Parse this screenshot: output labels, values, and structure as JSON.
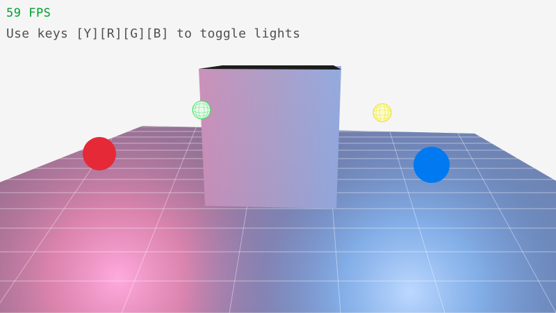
{
  "hud": {
    "fps": "59 FPS",
    "help": "Use keys [Y][R][G][B] to toggle lights"
  },
  "scene": {
    "background": "#f5f5f5",
    "cube_color": "#a7a0c8",
    "lights": [
      {
        "name": "yellow",
        "key": "Y",
        "color": "#fdf500",
        "enabled": false
      },
      {
        "name": "red",
        "key": "R",
        "color": "#e62937",
        "enabled": true
      },
      {
        "name": "green",
        "key": "G",
        "color": "#00e430",
        "enabled": false
      },
      {
        "name": "blue",
        "key": "B",
        "color": "#0079f1",
        "enabled": true
      }
    ]
  }
}
